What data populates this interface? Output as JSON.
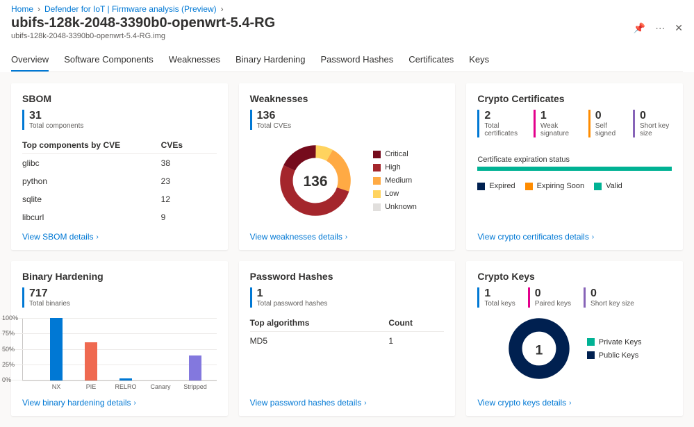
{
  "breadcrumb": {
    "home": "Home",
    "mid": "Defender for IoT | Firmware analysis (Preview)"
  },
  "page": {
    "title": "ubifs-128k-2048-3390b0-openwrt-5.4-RG",
    "subtitle": "ubifs-128k-2048-3390b0-openwrt-5.4-RG.img"
  },
  "tabs": {
    "overview": "Overview",
    "software": "Software Components",
    "weak": "Weaknesses",
    "binary": "Binary Hardening",
    "pwd": "Password Hashes",
    "certs": "Certificates",
    "keys": "Keys"
  },
  "sbom": {
    "title": "SBOM",
    "count": "31",
    "count_label": "Total components",
    "col1": "Top components by CVE",
    "col2": "CVEs",
    "rows": [
      {
        "name": "glibc",
        "cves": "38"
      },
      {
        "name": "python",
        "cves": "23"
      },
      {
        "name": "sqlite",
        "cves": "12"
      },
      {
        "name": "libcurl",
        "cves": "9"
      }
    ],
    "link": "View SBOM details"
  },
  "weaknesses": {
    "title": "Weaknesses",
    "count": "136",
    "count_label": "Total CVEs",
    "center": "136",
    "legend": [
      {
        "label": "Critical",
        "color": "#750b1c"
      },
      {
        "label": "High",
        "color": "#a4262c"
      },
      {
        "label": "Medium",
        "color": "#ffaa44"
      },
      {
        "label": "Low",
        "color": "#ffd35e"
      },
      {
        "label": "Unknown",
        "color": "#e1dfdd"
      }
    ],
    "link": "View weaknesses details"
  },
  "crypto_certs": {
    "title": "Crypto Certificates",
    "stats": [
      {
        "num": "2",
        "lbl": "Total certificates",
        "cls": ""
      },
      {
        "num": "1",
        "lbl": "Weak signature",
        "cls": "pink"
      },
      {
        "num": "0",
        "lbl": "Self signed",
        "cls": "orange"
      },
      {
        "num": "0",
        "lbl": "Short key size",
        "cls": "purple"
      }
    ],
    "sub": "Certificate expiration status",
    "legend": [
      {
        "label": "Expired",
        "color": "#002050"
      },
      {
        "label": "Expiring Soon",
        "color": "#ff8c00"
      },
      {
        "label": "Valid",
        "color": "#00b294"
      }
    ],
    "link": "View crypto certificates details"
  },
  "binary_hardening": {
    "title": "Binary Hardening",
    "count": "717",
    "count_label": "Total binaries",
    "yticks": [
      "100%",
      "75%",
      "50%",
      "25%",
      "0%"
    ],
    "link": "View binary hardening details"
  },
  "chart_data": {
    "type": "bar",
    "categories": [
      "NX",
      "PIE",
      "RELRO",
      "Canary",
      "Stripped"
    ],
    "values": [
      100,
      61,
      3,
      0,
      40
    ],
    "colors": [
      "#0078d4",
      "#ef6950",
      "#0078d4",
      "#0078d4",
      "#8378de"
    ],
    "ylabel": "Percent",
    "ylim": [
      0,
      100
    ]
  },
  "pwd": {
    "title": "Password Hashes",
    "count": "1",
    "count_label": "Total password hashes",
    "col1": "Top algorithms",
    "col2": "Count",
    "rows": [
      {
        "name": "MD5",
        "count": "1"
      }
    ],
    "link": "View password hashes details"
  },
  "crypto_keys": {
    "title": "Crypto Keys",
    "stats": [
      {
        "num": "1",
        "lbl": "Total keys",
        "cls": ""
      },
      {
        "num": "0",
        "lbl": "Paired keys",
        "cls": "pink"
      },
      {
        "num": "0",
        "lbl": "Short key size",
        "cls": "purple"
      }
    ],
    "center": "1",
    "legend": [
      {
        "label": "Private Keys",
        "color": "#00b294"
      },
      {
        "label": "Public Keys",
        "color": "#002050"
      }
    ],
    "link": "View crypto keys details"
  }
}
